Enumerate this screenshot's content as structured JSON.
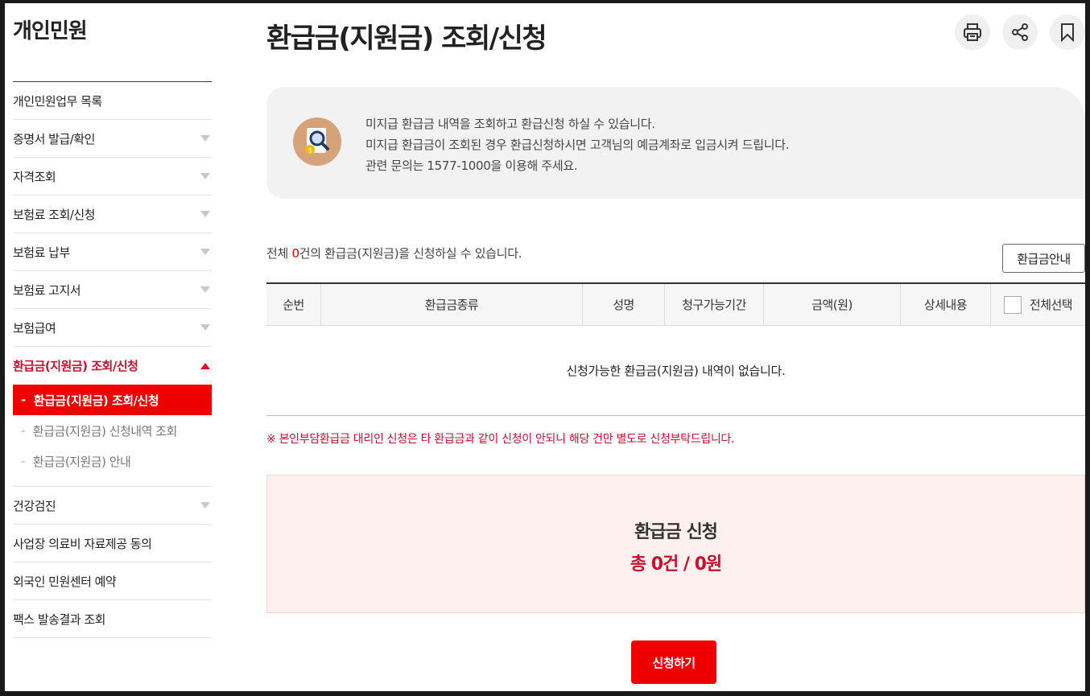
{
  "sidebar": {
    "title": "개인민원",
    "items": [
      {
        "label": "개인민원업무 목록",
        "arrow": false
      },
      {
        "label": "증명서 발급/확인",
        "arrow": true
      },
      {
        "label": "자격조회",
        "arrow": true
      },
      {
        "label": "보험료 조회/신청",
        "arrow": true
      },
      {
        "label": "보험료 납부",
        "arrow": true
      },
      {
        "label": "보험료 고지서",
        "arrow": true
      },
      {
        "label": "보험급여",
        "arrow": true
      }
    ],
    "active_item": {
      "label": "환급금(지원금) 조회/신청"
    },
    "sub_items": [
      {
        "label": "환급금(지원금) 조회/신청",
        "current": true
      },
      {
        "label": "환급금(지원금) 신청내역 조회",
        "current": false
      },
      {
        "label": "환급금(지원금) 안내",
        "current": false
      }
    ],
    "items_after": [
      {
        "label": "건강검진",
        "arrow": true
      },
      {
        "label": "사업장 의료비 자료제공 동의",
        "arrow": false
      },
      {
        "label": "외국인 민원센터 예약",
        "arrow": false
      },
      {
        "label": "팩스 발송결과 조회",
        "arrow": false
      }
    ],
    "dash": "-"
  },
  "page": {
    "title": "환급금(지원금) 조회/신청"
  },
  "tools": [
    "print-icon",
    "share-icon",
    "bookmark-icon"
  ],
  "info": {
    "line1": "미지급 환급금 내역을 조회하고 환급신청 하실 수 있습니다.",
    "line2": "미지급 환급금이 조회된 경우 환급신청하시면 고객님의 예금계좌로 입금시켜 드립니다.",
    "line3": "관련 문의는 1577-1000을 이용해 주세요."
  },
  "count": {
    "prefix": "전체 ",
    "number": "0",
    "suffix": "건의 환급금(지원금)을 신청하실 수 있습니다."
  },
  "guide_button": "환급금안내",
  "table": {
    "headers": [
      "순번",
      "환급금종류",
      "성명",
      "청구가능기간",
      "금액(원)",
      "상세내용",
      "전체선택"
    ],
    "empty_message": "신청가능한 환급금(지원금) 내역이 없습니다."
  },
  "notice": "※ 본인부담환급금 대리인 신청은 타 환급금과 같이 신청이 안되니 해당 건만 별도로 신청부탁드립니다.",
  "apply": {
    "title": "환급금 신청",
    "total": "총 0건 / 0원"
  },
  "submit_button": "신청하기",
  "colors": {
    "accent": "#ee0000",
    "accent_text": "#c8102e"
  }
}
